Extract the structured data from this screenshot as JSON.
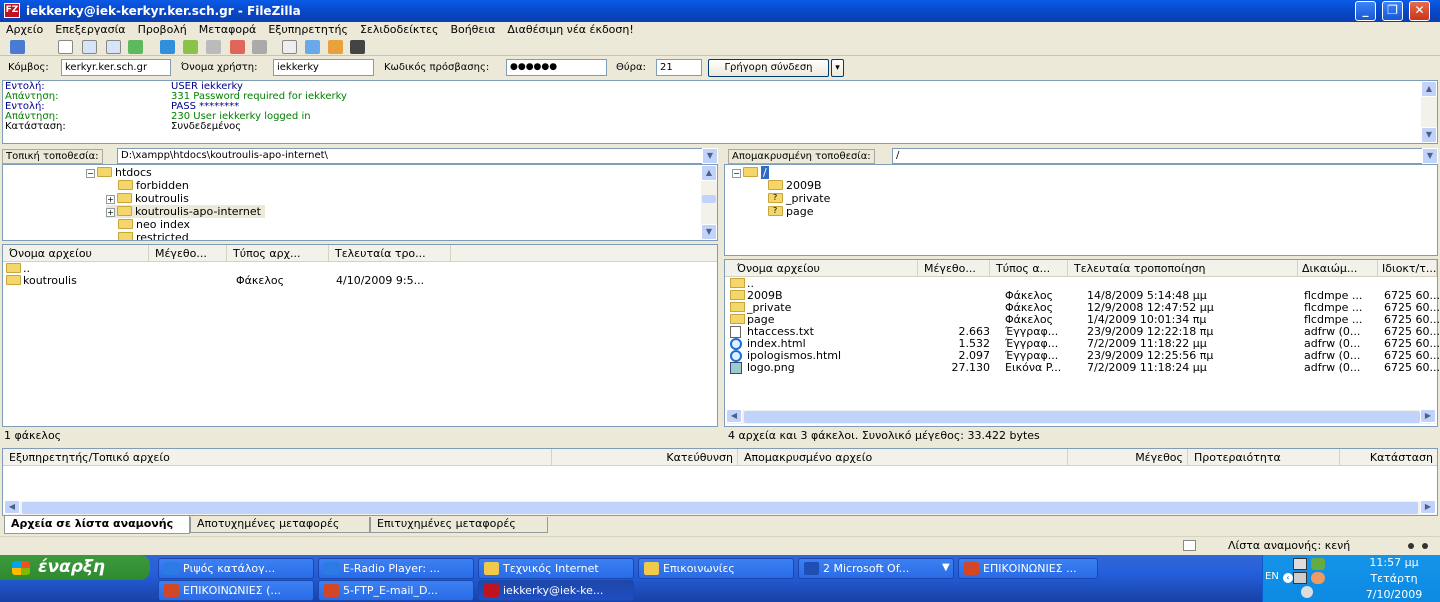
{
  "window": {
    "title": "iekkerky@iek-kerkyr.ker.sch.gr - FileZilla",
    "app_icon": "FZ"
  },
  "menu": [
    "Αρχείο",
    "Επεξεργασία",
    "Προβολή",
    "Μεταφορά",
    "Εξυπηρετητής",
    "Σελιδοδείκτες",
    "Βοήθεια",
    "Διαθέσιμη νέα έκδοση!"
  ],
  "quickconnect": {
    "host_label": "Κόμβος:",
    "host_value": "kerkyr.ker.sch.gr",
    "user_label": "Όνομα χρήστη:",
    "user_value": "iekkerky",
    "pass_label": "Κωδικός πρόσβασης:",
    "pass_value": "●●●●●●",
    "port_label": "Θύρα:",
    "port_value": "21",
    "button": "Γρήγορη σύνδεση",
    "dropdown": "▾"
  },
  "log": [
    {
      "label": "Εντολή:",
      "text": "USER iekkerky",
      "color": "navy"
    },
    {
      "label": "Απάντηση:",
      "text": "331 Password required for iekkerky",
      "color": "green"
    },
    {
      "label": "Εντολή:",
      "text": "PASS ********",
      "color": "navy"
    },
    {
      "label": "Απάντηση:",
      "text": "230 User iekkerky logged in",
      "color": "green"
    },
    {
      "label": "Κατάσταση:",
      "text": "Συνδεδεμένος",
      "color": "black"
    }
  ],
  "local": {
    "path_label": "Τοπική τοποθεσία:",
    "path_value": "D:\\xampp\\htdocs\\koutroulis-apo-internet\\",
    "tree": [
      {
        "name": "htdocs",
        "expander": "−"
      },
      {
        "name": "forbidden",
        "expander": ""
      },
      {
        "name": "koutroulis",
        "expander": "+"
      },
      {
        "name": "koutroulis-apo-internet",
        "expander": "+"
      },
      {
        "name": "neo index",
        "expander": ""
      },
      {
        "name": "restricted",
        "expander": ""
      }
    ],
    "columns": [
      "Όνομα αρχείου",
      "Μέγεθο...",
      "Τύπος αρχ...",
      "Τελευταία τρο..."
    ],
    "files": [
      {
        "name": "..",
        "size": "",
        "type": "",
        "modified": ""
      },
      {
        "name": "koutroulis",
        "size": "",
        "type": "Φάκελος",
        "modified": "4/10/2009 9:5..."
      }
    ],
    "status": "1 φάκελος"
  },
  "remote": {
    "path_label": "Απομακρυσμένη τοποθεσία:",
    "path_value": "/",
    "tree": [
      {
        "name": "/",
        "expander": "−"
      },
      {
        "name": "2009B",
        "expander": ""
      },
      {
        "name": "_private",
        "expander": ""
      },
      {
        "name": "page",
        "expander": ""
      }
    ],
    "columns": [
      "Όνομα αρχείου",
      "Μέγεθο...",
      "Τύπος α...",
      "Τελευταία τροποποίηση",
      "Δικαιώμ...",
      "Ιδιοκτ/τ..."
    ],
    "files": [
      {
        "name": "..",
        "size": "",
        "type": "",
        "modified": "",
        "perms": "",
        "owner": "",
        "icon": "folder"
      },
      {
        "name": "2009B",
        "size": "",
        "type": "Φάκελος",
        "modified": "14/8/2009 5:14:48 μμ",
        "perms": "flcdmpe ...",
        "owner": "6725 60...",
        "icon": "folder"
      },
      {
        "name": "_private",
        "size": "",
        "type": "Φάκελος",
        "modified": "12/9/2008 12:47:52 μμ",
        "perms": "flcdmpe ...",
        "owner": "6725 60...",
        "icon": "folder"
      },
      {
        "name": "page",
        "size": "",
        "type": "Φάκελος",
        "modified": "1/4/2009 10:01:34 πμ",
        "perms": "flcdmpe ...",
        "owner": "6725 60...",
        "icon": "folder"
      },
      {
        "name": "htaccess.txt",
        "size": "2.663",
        "type": "Έγγραφ...",
        "modified": "23/9/2009 12:22:18 πμ",
        "perms": "adfrw (0...",
        "owner": "6725 60...",
        "icon": "text"
      },
      {
        "name": "index.html",
        "size": "1.532",
        "type": "Έγγραφ...",
        "modified": "7/2/2009 11:18:22 μμ",
        "perms": "adfrw (0...",
        "owner": "6725 60...",
        "icon": "ie"
      },
      {
        "name": "ipologismos.html",
        "size": "2.097",
        "type": "Έγγραφ...",
        "modified": "23/9/2009 12:25:56 πμ",
        "perms": "adfrw (0...",
        "owner": "6725 60...",
        "icon": "ie"
      },
      {
        "name": "logo.png",
        "size": "27.130",
        "type": "Εικόνα P...",
        "modified": "7/2/2009 11:18:24 μμ",
        "perms": "adfrw (0...",
        "owner": "6725 60...",
        "icon": "image"
      }
    ],
    "status": "4 αρχεία και 3 φάκελοι. Συνολικό μέγεθος: 33.422 bytes"
  },
  "queue": {
    "columns": [
      "Εξυπηρετητής/Τοπικό αρχείο",
      "Κατεύθυνση",
      "Απομακρυσμένο αρχείο",
      "Μέγεθος",
      "Προτεραιότητα",
      "Κατάσταση"
    ],
    "tabs": [
      "Αρχεία σε λίστα αναμονής",
      "Αποτυχημένες μεταφορές",
      "Επιτυχημένες μεταφορές"
    ],
    "status": "Λίστα αναμονής: κενή"
  },
  "taskbar": {
    "start": "έναρξη",
    "row1": [
      {
        "label": "Ριψός κατάλογ...",
        "icon": "ie"
      },
      {
        "label": "E-Radio Player: ...",
        "icon": "ie"
      },
      {
        "label": "Τεχνικός Internet",
        "icon": "folder"
      },
      {
        "label": "Επικοινωνίες",
        "icon": "folder"
      },
      {
        "label": "2 Microsoft Of...",
        "icon": "word"
      },
      {
        "label": "ΕΠΙΚΟΙΝΩΝΙΕΣ ...",
        "icon": "ppt"
      }
    ],
    "row2": [
      {
        "label": "ΕΠΙΚΟΙΝΩΝΙΕΣ (...",
        "icon": "ppt"
      },
      {
        "label": "5-FTP_E-mail_D...",
        "icon": "ppt"
      },
      {
        "label": "iekkerky@iek-ke...",
        "icon": "fz"
      }
    ],
    "lang": "EN",
    "time": "11:57 μμ",
    "day": "Τετάρτη",
    "date": "7/10/2009"
  }
}
